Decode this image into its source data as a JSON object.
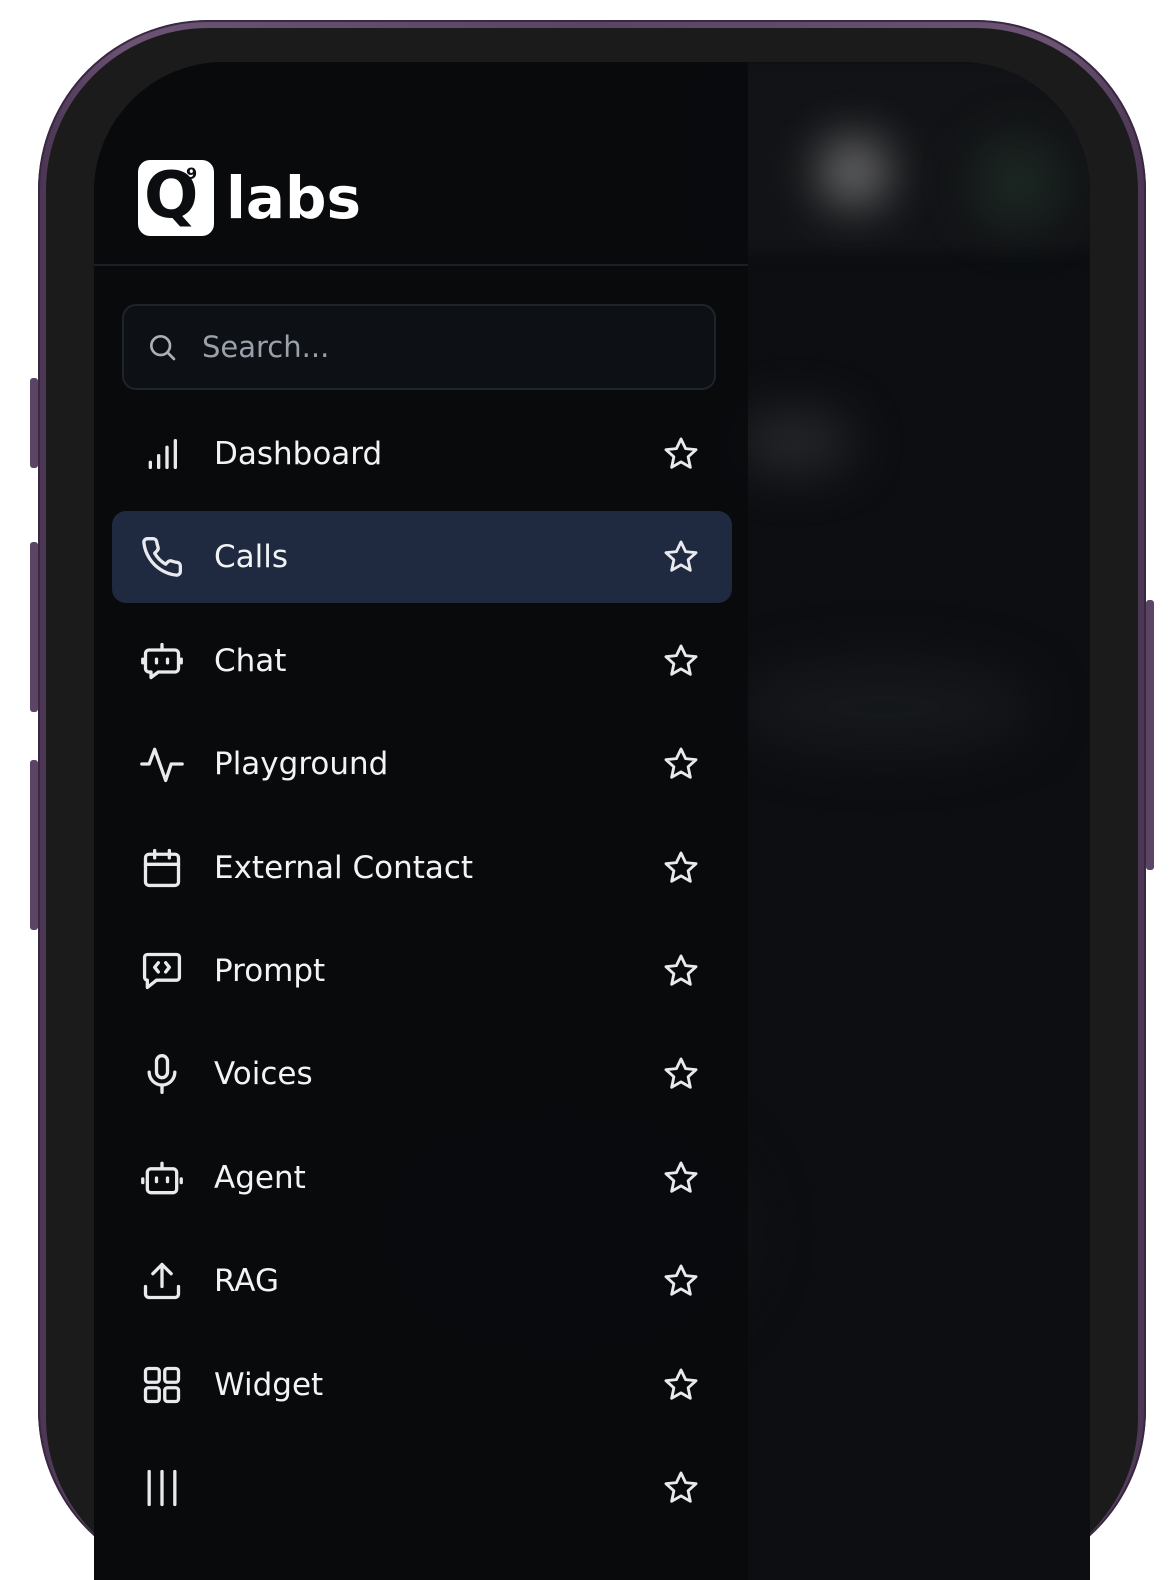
{
  "brand": {
    "logo_letter": "Q",
    "logo_superscript": "9",
    "logo_word": "labs"
  },
  "search": {
    "placeholder": "Search..."
  },
  "nav": {
    "items": [
      {
        "label": "Dashboard",
        "icon": "bar-chart-icon",
        "active": false
      },
      {
        "label": "Calls",
        "icon": "phone-icon",
        "active": true
      },
      {
        "label": "Chat",
        "icon": "chat-bot-icon",
        "active": false
      },
      {
        "label": "Playground",
        "icon": "activity-icon",
        "active": false
      },
      {
        "label": "External Contact",
        "icon": "calendar-icon",
        "active": false
      },
      {
        "label": "Prompt",
        "icon": "code-message-icon",
        "active": false
      },
      {
        "label": "Voices",
        "icon": "microphone-icon",
        "active": false
      },
      {
        "label": "Agent",
        "icon": "bot-icon",
        "active": false
      },
      {
        "label": "RAG",
        "icon": "upload-icon",
        "active": false
      },
      {
        "label": "Widget",
        "icon": "grid-icon",
        "active": false
      }
    ]
  },
  "colors": {
    "active_item_bg": "#1f2a40",
    "device_frame": "#5a4463"
  }
}
